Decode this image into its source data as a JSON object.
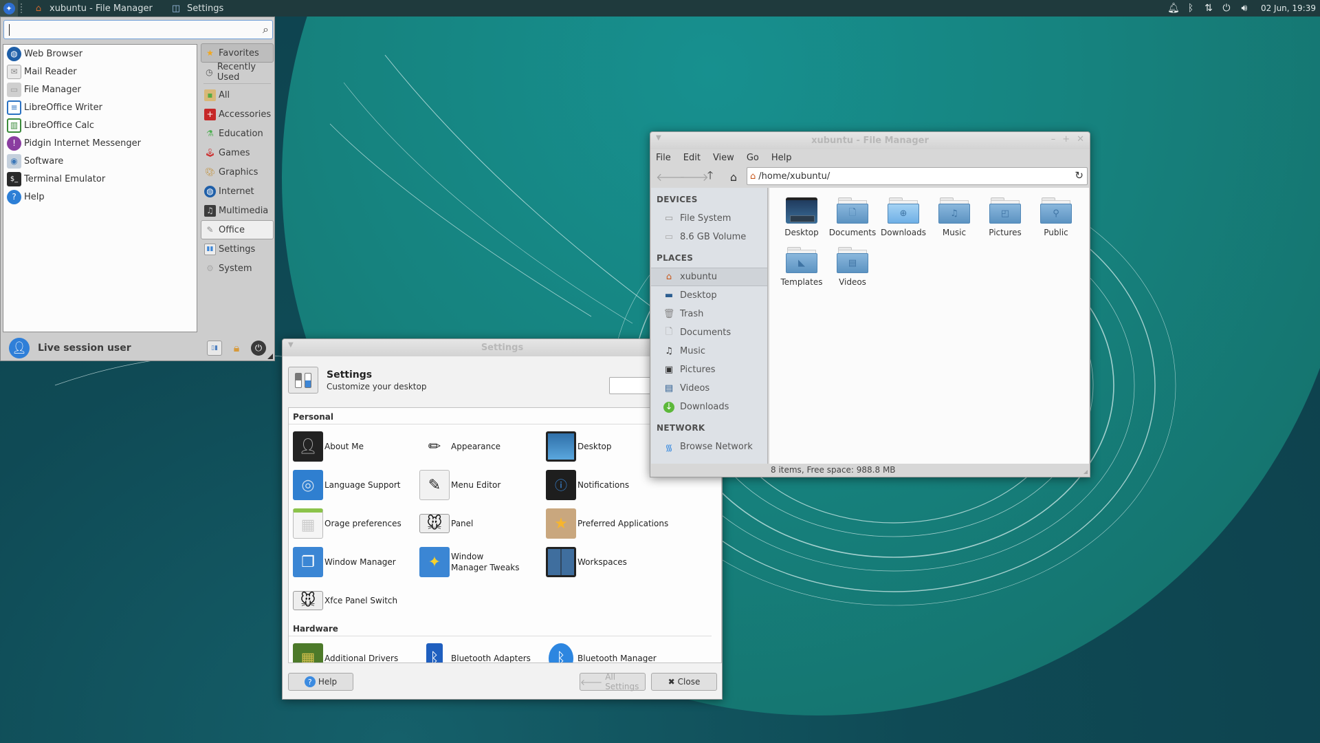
{
  "top_panel": {
    "tasks": [
      {
        "label": "xubuntu - File Manager",
        "icon": "home-icon"
      },
      {
        "label": "Settings",
        "icon": "settings-icon"
      }
    ],
    "tray_icons": [
      "notification-bell-icon",
      "bluetooth-icon",
      "network-transfer-icon",
      "power-icon",
      "volume-icon"
    ],
    "clock": "02 Jun, 19:39"
  },
  "whisker_menu": {
    "search": {
      "value": "",
      "placeholder": ""
    },
    "apps": [
      {
        "label": "Web Browser",
        "icon": "globe-icon",
        "color": "#1f5fa8"
      },
      {
        "label": "Mail Reader",
        "icon": "envelope-icon",
        "color": "#dcdcdc"
      },
      {
        "label": "File Manager",
        "icon": "folder-icon",
        "color": "#c9c9c9"
      },
      {
        "label": "LibreOffice Writer",
        "icon": "writer-icon",
        "color": "#2a71c2"
      },
      {
        "label": "LibreOffice Calc",
        "icon": "calc-icon",
        "color": "#3a8a3a"
      },
      {
        "label": "Pidgin Internet Messenger",
        "icon": "pidgin-icon",
        "color": "#8a3da0"
      },
      {
        "label": "Software",
        "icon": "software-icon",
        "color": "#8aa2bc"
      },
      {
        "label": "Terminal Emulator",
        "icon": "terminal-icon",
        "color": "#2a2a2a"
      },
      {
        "label": "Help",
        "icon": "help-icon",
        "color": "#2d7fd6"
      }
    ],
    "categories": [
      {
        "label": "Favorites",
        "icon": "star-icon",
        "state": "selected"
      },
      {
        "label": "Recently Used",
        "icon": "clock-icon",
        "state": ""
      },
      {
        "label": "All",
        "icon": "all-apps-icon",
        "state": ""
      },
      {
        "label": "Accessories",
        "icon": "accessories-icon",
        "state": ""
      },
      {
        "label": "Education",
        "icon": "education-icon",
        "state": ""
      },
      {
        "label": "Games",
        "icon": "games-icon",
        "state": ""
      },
      {
        "label": "Graphics",
        "icon": "graphics-icon",
        "state": ""
      },
      {
        "label": "Internet",
        "icon": "internet-icon",
        "state": ""
      },
      {
        "label": "Multimedia",
        "icon": "multimedia-icon",
        "state": ""
      },
      {
        "label": "Office",
        "icon": "office-icon",
        "state": "hover"
      },
      {
        "label": "Settings",
        "icon": "settings-icon",
        "state": ""
      },
      {
        "label": "System",
        "icon": "system-gear-icon",
        "state": ""
      }
    ],
    "user": "Live session user",
    "actions": [
      "settings-manager-icon",
      "lock-icon",
      "power-icon"
    ]
  },
  "file_manager": {
    "title": "xubuntu - File Manager",
    "menu": [
      "File",
      "Edit",
      "View",
      "Go",
      "Help"
    ],
    "path": "/home/xubuntu/",
    "sidebar": {
      "devices_label": "DEVICES",
      "devices": [
        {
          "label": "File System",
          "icon": "drive-icon"
        },
        {
          "label": "8.6 GB Volume",
          "icon": "drive-icon"
        }
      ],
      "places_label": "PLACES",
      "places": [
        {
          "label": "xubuntu",
          "icon": "home-icon",
          "selected": true
        },
        {
          "label": "Desktop",
          "icon": "desktop-icon"
        },
        {
          "label": "Trash",
          "icon": "trash-icon"
        },
        {
          "label": "Documents",
          "icon": "document-icon"
        },
        {
          "label": "Music",
          "icon": "music-icon"
        },
        {
          "label": "Pictures",
          "icon": "pictures-icon"
        },
        {
          "label": "Videos",
          "icon": "videos-icon"
        },
        {
          "label": "Downloads",
          "icon": "downloads-icon"
        }
      ],
      "network_label": "NETWORK",
      "network": [
        {
          "label": "Browse Network",
          "icon": "wifi-icon"
        }
      ]
    },
    "files": [
      {
        "name": "Desktop",
        "type": "desktop"
      },
      {
        "name": "Documents",
        "glyph": "🗋"
      },
      {
        "name": "Downloads",
        "glyph": "⊕"
      },
      {
        "name": "Music",
        "glyph": "♫"
      },
      {
        "name": "Pictures",
        "glyph": "◰"
      },
      {
        "name": "Public",
        "glyph": "⚲"
      },
      {
        "name": "Templates",
        "glyph": "◣"
      },
      {
        "name": "Videos",
        "glyph": "▤"
      }
    ],
    "status": "8 items, Free space: 988.8 MB"
  },
  "settings": {
    "title": "Settings",
    "header_title": "Settings",
    "header_subtitle": "Customize your desktop",
    "search": {
      "value": "",
      "placeholder": ""
    },
    "groups": [
      {
        "label": "Personal",
        "items": [
          {
            "label": "About Me",
            "icon": "about-me-icon"
          },
          {
            "label": "Appearance",
            "icon": "appearance-icon"
          },
          {
            "label": "Desktop",
            "icon": "desktop-icon"
          },
          {
            "label": "Language Support",
            "icon": "language-icon"
          },
          {
            "label": "Menu Editor",
            "icon": "menu-editor-icon"
          },
          {
            "label": "Notifications",
            "icon": "notifications-icon"
          },
          {
            "label": "Orage preferences",
            "icon": "calendar-icon"
          },
          {
            "label": "Panel",
            "icon": "panel-icon"
          },
          {
            "label": "Preferred Applications",
            "icon": "preferred-apps-icon"
          },
          {
            "label": "Window Manager",
            "icon": "window-manager-icon"
          },
          {
            "label": "Window Manager Tweaks",
            "icon": "wm-tweaks-icon"
          },
          {
            "label": "Workspaces",
            "icon": "workspaces-icon"
          },
          {
            "label": "Xfce Panel Switch",
            "icon": "panel-switch-icon"
          }
        ]
      },
      {
        "label": "Hardware",
        "items": [
          {
            "label": "Additional Drivers",
            "icon": "drivers-icon"
          },
          {
            "label": "Bluetooth Adapters",
            "icon": "bluetooth-adapter-icon"
          },
          {
            "label": "Bluetooth Manager",
            "icon": "bluetooth-icon"
          }
        ]
      }
    ],
    "buttons": {
      "help": "Help",
      "all_settings": "All Settings",
      "close": "Close"
    }
  }
}
